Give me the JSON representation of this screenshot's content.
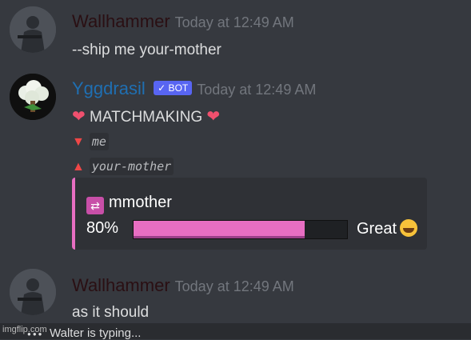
{
  "messages": [
    {
      "author": "Wallhammer",
      "timestamp": "Today at 12:49 AM",
      "text": "--ship me your-mother",
      "author_color": "#2a0f13"
    },
    {
      "author": "Yggdrasil",
      "bot_tag": "✓ BOT",
      "timestamp": "Today at 12:49 AM",
      "title": "MATCHMAKING",
      "down_label": "me",
      "up_label": "your-mother",
      "author_color": "#1f6fb2",
      "embed": {
        "title": "mmother",
        "percent_label": "80%",
        "percent_value": 0.8,
        "rating": "Great",
        "accent_color": "#e86ec2",
        "icon": "shuffle-icon"
      }
    },
    {
      "author": "Wallhammer",
      "timestamp": "Today at 12:49 AM",
      "text": "as it should",
      "author_color": "#2a0f13"
    }
  ],
  "typing_indicator": "Walter is typing...",
  "watermark": "imgflip.com"
}
